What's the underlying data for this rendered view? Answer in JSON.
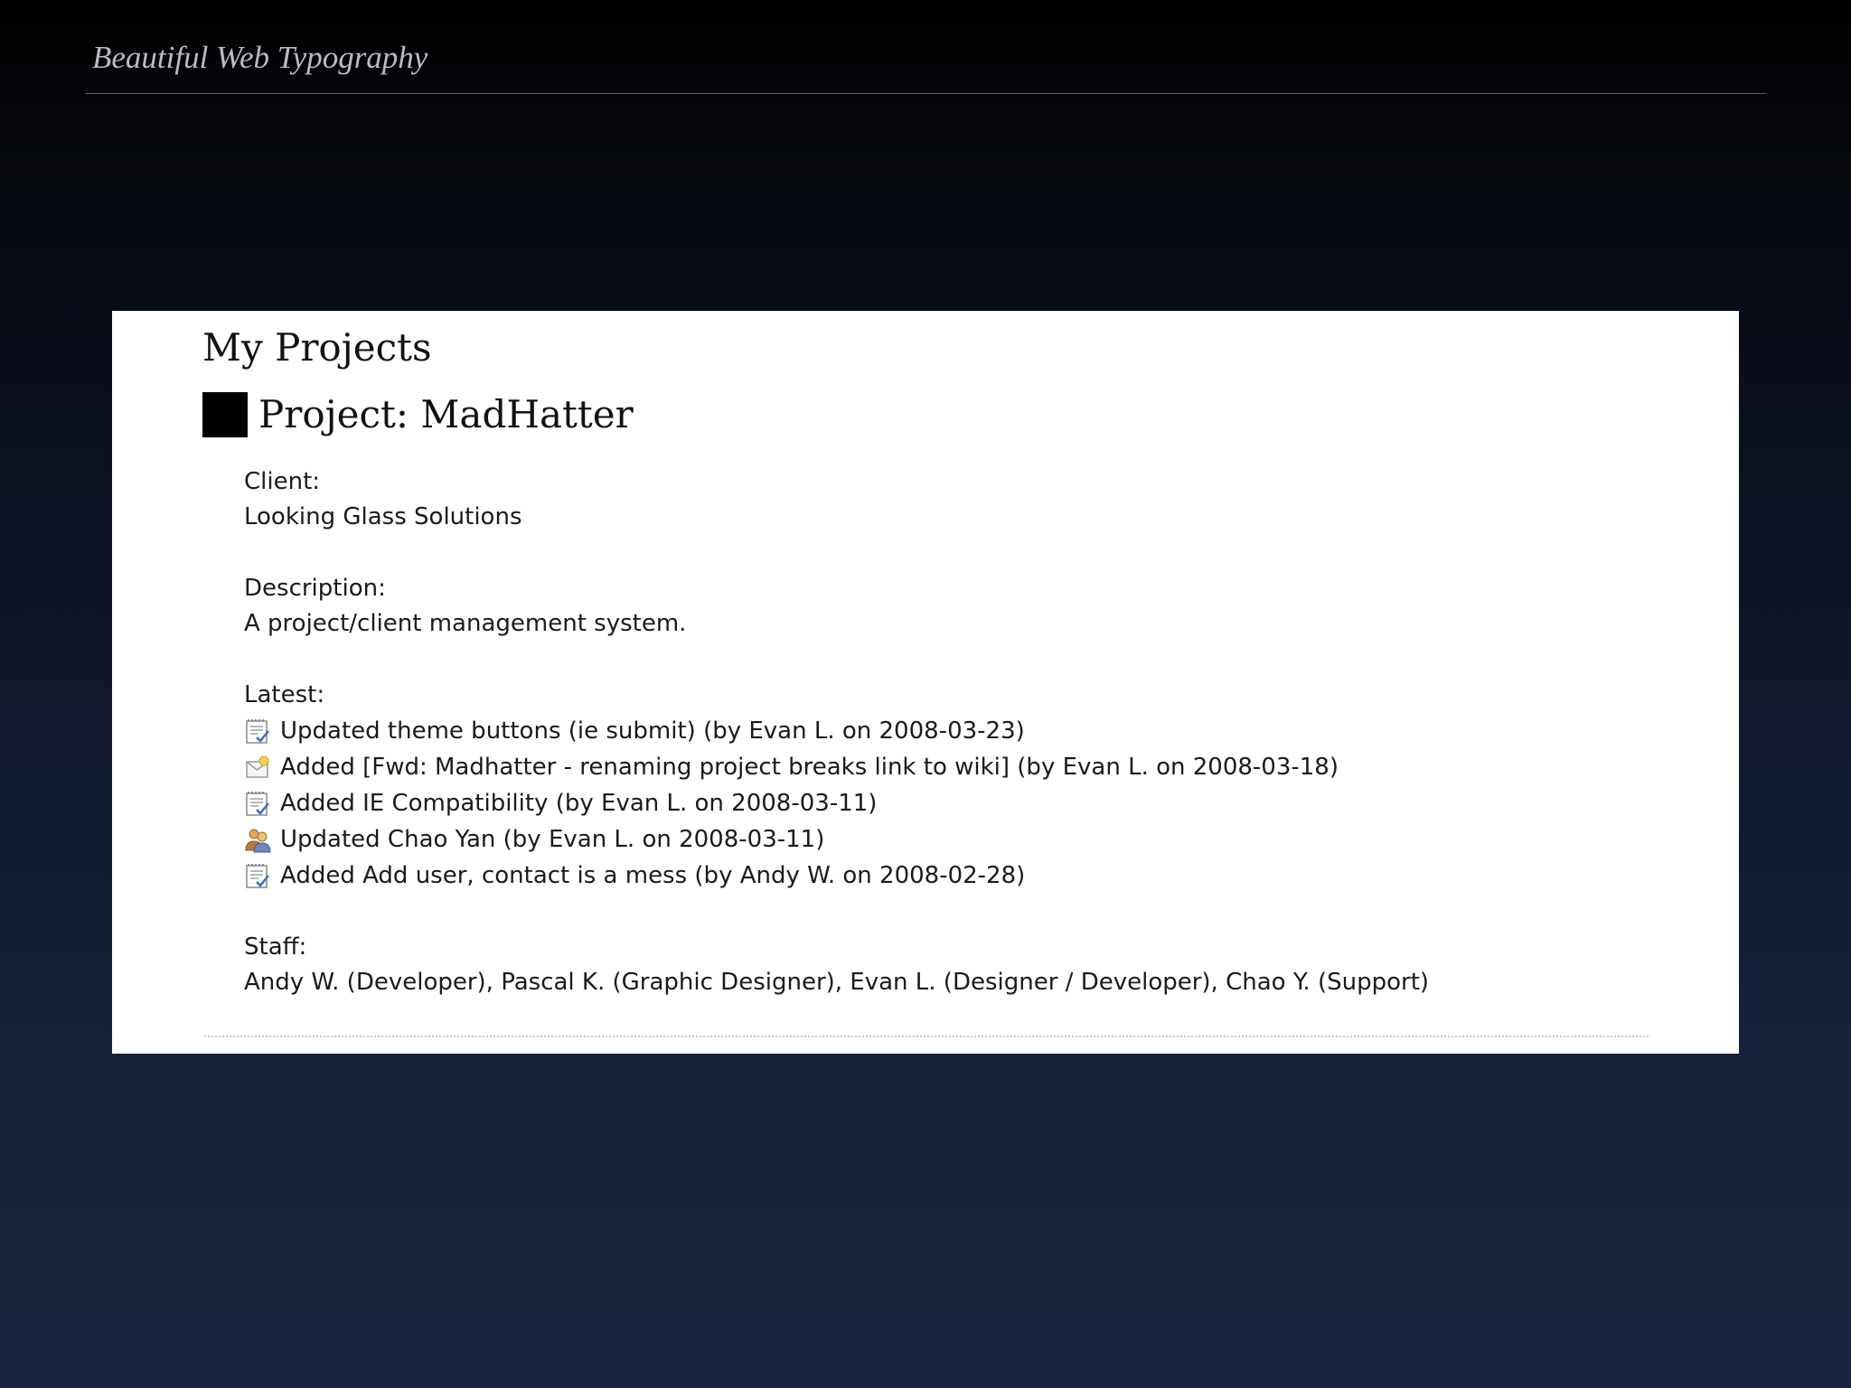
{
  "slide": {
    "header_title": "Beautiful Web Typography"
  },
  "page": {
    "title": "My Projects",
    "project_heading": "Project: MadHatter",
    "client_label": "Client:",
    "client_value": "Looking Glass Solutions",
    "description_label": "Description:",
    "description_value": "A project/client management system.",
    "latest_label": "Latest:",
    "latest": [
      {
        "icon": "notepad-check-icon",
        "text": "Updated theme buttons (ie submit) (by Evan L. on 2008-03-23)"
      },
      {
        "icon": "mail-icon",
        "text": "Added [Fwd: Madhatter - renaming project breaks link to wiki] (by Evan L. on 2008-03-18)"
      },
      {
        "icon": "notepad-check-icon",
        "text": "Added IE Compatibility (by Evan L. on 2008-03-11)"
      },
      {
        "icon": "users-icon",
        "text": "Updated Chao Yan (by Evan L. on 2008-03-11)"
      },
      {
        "icon": "notepad-check-icon",
        "text": "Added Add user, contact is a mess (by Andy W. on 2008-02-28)"
      }
    ],
    "staff_label": "Staff:",
    "staff_value": "Andy W. (Developer), Pascal K. (Graphic Designer), Evan L. (Designer / Developer), Chao Y. (Support)"
  },
  "colors": {
    "slide_background_top": "#000000",
    "slide_background_bottom": "#1b2340",
    "header_text": "#b9bcc4",
    "panel_background": "#ffffff",
    "project_square": "#000000"
  }
}
